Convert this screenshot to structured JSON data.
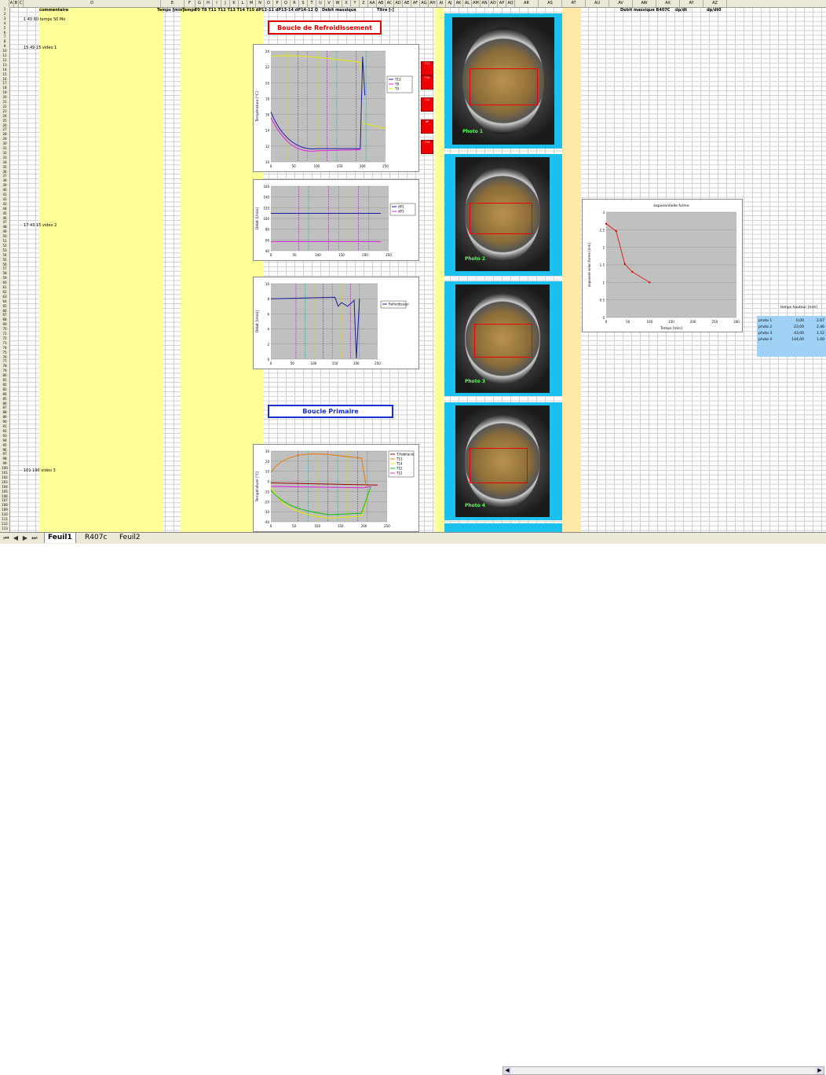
{
  "columns": [
    "A",
    "B",
    "C",
    "D",
    "E",
    "F",
    "G",
    "H",
    "I",
    "J",
    "K",
    "L",
    "M",
    "N",
    "O",
    "P",
    "Q",
    "R",
    "S",
    "T",
    "U",
    "V",
    "W",
    "X",
    "Y",
    "Z",
    "AA",
    "AB",
    "AC",
    "AD",
    "AE",
    "AF",
    "AG",
    "AH",
    "AI",
    "AJ",
    "AK",
    "AL",
    "AM",
    "AN",
    "AO",
    "AP",
    "AQ",
    "AR",
    "AS",
    "AT",
    "AU",
    "AV",
    "AW",
    "AX",
    "AY",
    "AZ"
  ],
  "header_row": {
    "commentaire": "commentaire",
    "temps_min": "Temps [min]",
    "temps": "Temps",
    "t_cols": "T0 T8 T11 T12 T13 T14 T15 dP12-11 dP13-14 dP14-12 Q",
    "debit": "Débit massique",
    "titre": "Titre [-]",
    "dpdt": "Débit massique R407C",
    "dp": "dp/dt",
    "dp2": "dp/dt0"
  },
  "row_comments": [
    "1 40 60 temps 50 Mo",
    "15 49 15 vidéo 1",
    "17 43 15 vidéo 2",
    "101 190 vidéo 3"
  ],
  "banners": {
    "refroidissement": "Boucle de Refroidissement",
    "primaire": "Boucle Primaire"
  },
  "charts": [
    {
      "id": "refroidissement-temps",
      "ylabel": "Température [°C]",
      "xticks": [
        "0",
        "50",
        "100",
        "150",
        "200",
        "250"
      ],
      "yticks": [
        "24",
        "22",
        "20",
        "18",
        "16",
        "14",
        "12",
        "10"
      ],
      "legend": [
        "T11",
        "T8",
        "T9"
      ]
    },
    {
      "id": "debit",
      "ylabel": "Débit [l/min]",
      "xticks": [
        "0",
        "50",
        "100",
        "150",
        "200",
        "250"
      ],
      "yticks": [
        "160",
        "140",
        "120",
        "100",
        "80",
        "60",
        "40"
      ],
      "legend": [
        "dP1",
        "dP3"
      ]
    },
    {
      "id": "refroidisseur",
      "ylabel": "Débit [l/min]",
      "xticks": [
        "0",
        "50",
        "100",
        "150",
        "200",
        "250"
      ],
      "yticks": [
        "10",
        "8",
        "6",
        "4",
        "2",
        "0"
      ],
      "legend": [
        "Refroidisseur"
      ]
    },
    {
      "id": "primaire-temps",
      "ylabel": "Température [°C]",
      "xticks": [
        "0",
        "50",
        "100",
        "150",
        "200",
        "250"
      ],
      "yticks": [
        "30",
        "20",
        "10",
        "0",
        "-10",
        "-20",
        "-30",
        "-40"
      ],
      "legend": [
        "T.Habitacle",
        "T13",
        "T14",
        "T15",
        "T12"
      ]
    }
  ],
  "side_chart": {
    "title": "exponentielle forme",
    "ylabel": "exponent selon forme [mm]",
    "xlabel": "Temps [min]",
    "xticks": [
      "0",
      "50",
      "100",
      "150",
      "200",
      "250",
      "300"
    ],
    "yticks": [
      "3",
      "2.5",
      "2",
      "1.5",
      "1",
      "0.5",
      "0"
    ]
  },
  "photos": [
    {
      "label": "Photo 1"
    },
    {
      "label": "Photo 2"
    },
    {
      "label": "Photo 3"
    },
    {
      "label": "Photo 4"
    }
  ],
  "red_boxes": [
    "T11",
    "T12",
    "T13",
    "dP",
    "T15"
  ],
  "photo_table": {
    "headers": [
      "temps",
      "hauteur [mm]"
    ],
    "rows": [
      [
        "photo 1",
        "0,00",
        "2,67"
      ],
      [
        "photo 2",
        "23,00",
        "2,46"
      ],
      [
        "photo 3",
        "43,00",
        "1,52"
      ],
      [
        "photo 4",
        "144,00",
        "1,00"
      ]
    ]
  },
  "tabs": [
    "Feuil1",
    "R407c",
    "Feuil2"
  ],
  "colors": {
    "grid": "#d0d0d0",
    "photo_frame": "#1cc0ee",
    "banner_red": "#e00000",
    "banner_blue": "#1a2fd0",
    "yellow_band": "#ffff99"
  }
}
